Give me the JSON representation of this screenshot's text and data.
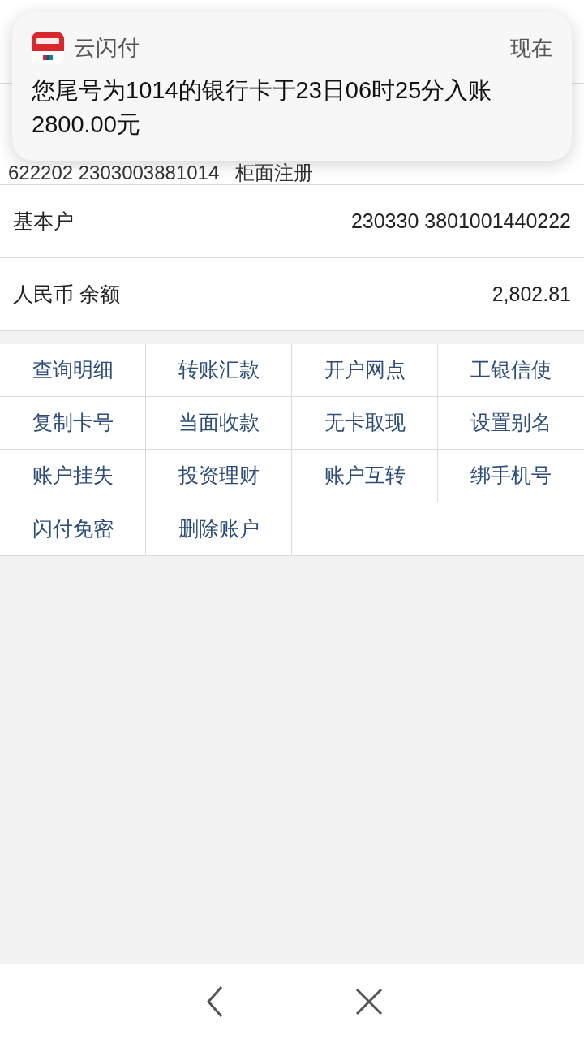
{
  "notification": {
    "app": "云闪付",
    "time": "现在",
    "message": "您尾号为1014的银行卡于23日06时25分入账2800.00元"
  },
  "card": {
    "number_line": "622202 2303003881014   柜面注册"
  },
  "rows": [
    {
      "label": "基本户",
      "value": "230330 3801001440222"
    },
    {
      "label": "人民币 余额",
      "value": "2,802.81"
    }
  ],
  "actions": [
    "查询明细",
    "转账汇款",
    "开户网点",
    "工银信使",
    "复制卡号",
    "当面收款",
    "无卡取现",
    "设置别名",
    "账户挂失",
    "投资理财",
    "账户互转",
    "绑手机号",
    "闪付免密",
    "删除账户"
  ]
}
